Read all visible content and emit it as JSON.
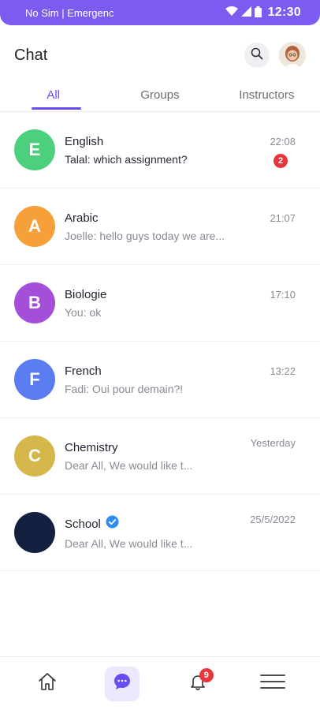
{
  "status_bar": {
    "carrier": "No Sim | Emergenc",
    "time": "12:30",
    "icons": [
      "wifi-icon",
      "signal-icon",
      "battery-icon"
    ]
  },
  "header": {
    "title": "Chat",
    "search_icon": "search-icon",
    "avatar_icon": "user-avatar"
  },
  "tabs": [
    {
      "label": "All",
      "active": true
    },
    {
      "label": "Groups",
      "active": false
    },
    {
      "label": "Instructors",
      "active": false
    }
  ],
  "chats": [
    {
      "initial": "E",
      "name": "English",
      "preview": "Talal: which assignment?",
      "time": "22:08",
      "unread": "2",
      "color": "#4cd07d",
      "preview_dark": true
    },
    {
      "initial": "A",
      "name": "Arabic",
      "preview": "Joelle: hello guys today we are...",
      "time": "21:07",
      "unread": "",
      "color": "#f6a03a",
      "preview_dark": false
    },
    {
      "initial": "B",
      "name": "Biologie",
      "preview": "You: ok",
      "time": "17:10",
      "unread": "",
      "color": "#a44fd8",
      "preview_dark": false
    },
    {
      "initial": "F",
      "name": "French",
      "preview": "Fadi: Oui pour demain?!",
      "time": "13:22",
      "unread": "",
      "color": "#5c7cf2",
      "preview_dark": false
    },
    {
      "initial": "C",
      "name": "Chemistry",
      "preview": "Dear All, We would like t...",
      "time": "Yesterday",
      "unread": "",
      "color": "#d4b64a",
      "preview_dark": false
    },
    {
      "initial": "",
      "name": "School",
      "preview": "Dear All, We would like t...",
      "time": "25/5/2022",
      "unread": "",
      "color": "#13203f",
      "preview_dark": false,
      "verified": true
    }
  ],
  "bottom_nav": {
    "items": [
      {
        "icon": "home-icon",
        "active": false
      },
      {
        "icon": "chat-icon",
        "active": true
      },
      {
        "icon": "bell-icon",
        "active": false,
        "badge": "9"
      },
      {
        "icon": "menu-icon",
        "active": false
      }
    ]
  },
  "colors": {
    "accent": "#6a4df0",
    "status_bar": "#7c5cf0",
    "badge": "#e8363d"
  }
}
